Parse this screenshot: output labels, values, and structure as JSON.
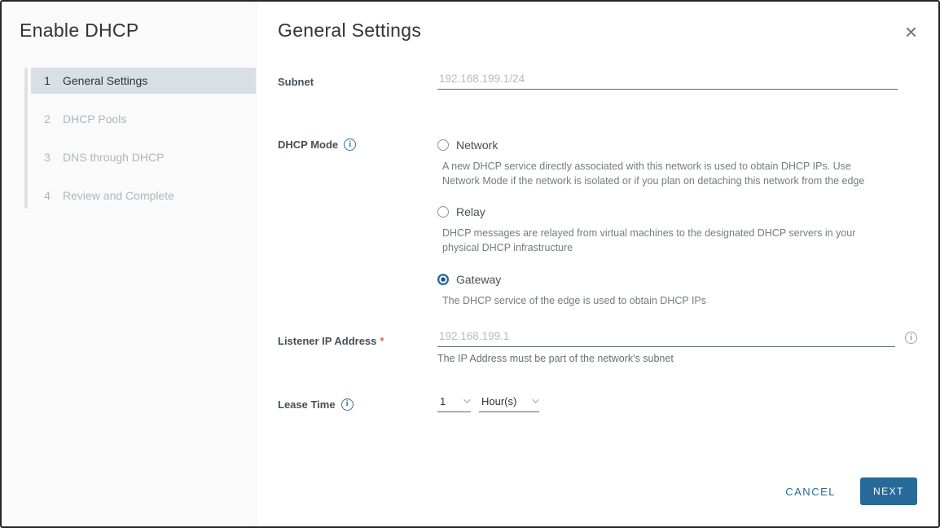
{
  "dialog": {
    "title": "Enable DHCP"
  },
  "sidebar": {
    "steps": [
      {
        "num": "1",
        "label": "General Settings",
        "active": true
      },
      {
        "num": "2",
        "label": "DHCP Pools",
        "active": false
      },
      {
        "num": "3",
        "label": "DNS through DHCP",
        "active": false
      },
      {
        "num": "4",
        "label": "Review and Complete",
        "active": false
      }
    ]
  },
  "header": {
    "title": "General Settings",
    "close_icon": "×"
  },
  "form": {
    "subnet": {
      "label": "Subnet",
      "placeholder": "192.168.199.1/24",
      "value": ""
    },
    "dhcp_mode": {
      "label": "DHCP Mode",
      "info_icon": "i",
      "options": [
        {
          "label": "Network",
          "desc": "A new DHCP service directly associated with this network is used to obtain DHCP IPs. Use Network Mode if the network is isolated or if you plan on detaching this network from the edge",
          "selected": false
        },
        {
          "label": "Relay",
          "desc": "DHCP messages are relayed from virtual machines to the designated DHCP servers in your physical DHCP infrastructure",
          "selected": false
        },
        {
          "label": "Gateway",
          "desc": "The DHCP service of the edge is used to obtain DHCP IPs",
          "selected": true
        }
      ]
    },
    "listener_ip": {
      "label": "Listener IP Address",
      "required_marker": "*",
      "placeholder": "192.168.199.1",
      "value": "",
      "hint": "The IP Address must be part of the network's subnet",
      "info_icon": "i"
    },
    "lease_time": {
      "label": "Lease Time",
      "info_icon": "i",
      "value": "1",
      "unit": "Hour(s)"
    }
  },
  "footer": {
    "cancel_label": "CANCEL",
    "next_label": "NEXT"
  },
  "colors": {
    "accent_blue": "#2a6b99",
    "step_active_bg": "#d8dfe5",
    "required_red": "#c92100",
    "sidebar_bg": "#fafafa"
  }
}
